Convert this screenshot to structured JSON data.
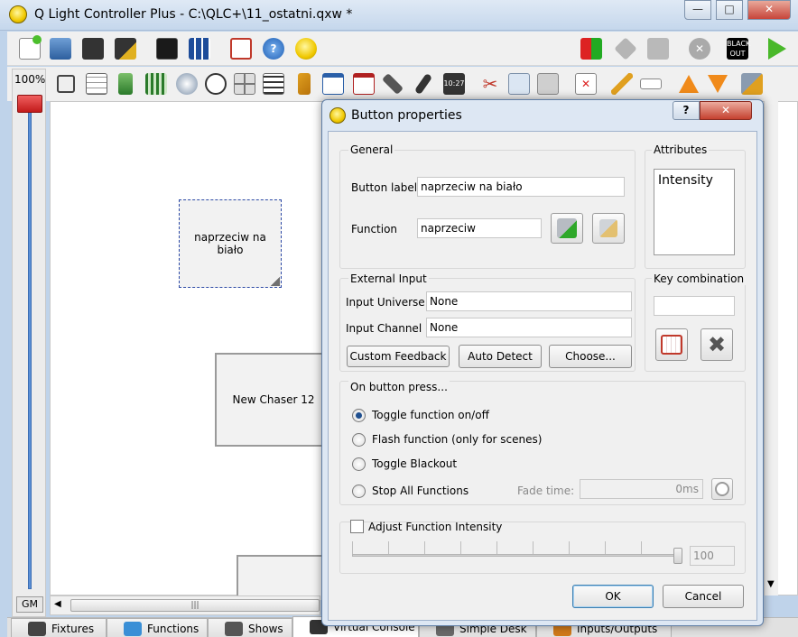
{
  "window": {
    "title": "Q Light Controller Plus - C:\\QLC+\\11_ostatni.qxw *",
    "minimize_glyph": "—",
    "maximize_glyph": "□",
    "close_glyph": "✕"
  },
  "toolbar_main": {
    "icons": [
      "new-file-icon",
      "open-file-icon",
      "save-file-icon",
      "save-as-icon",
      "monitor-icon",
      "address-tool-icon",
      "fullscreen-icon",
      "help-icon",
      "about-icon",
      "mode-switch-icon",
      "panic-icon",
      "stop-all-icon",
      "cross-icon",
      "blackout-icon",
      "play-icon"
    ],
    "blackout_label": "BLACK OUT"
  },
  "toolbar_vc": {
    "icons": [
      "button-icon",
      "button-matrix-icon",
      "slider-icon",
      "slider-matrix-icon",
      "knob-icon",
      "speed-dial-icon",
      "xy-pad-icon",
      "cue-list-icon",
      "label-icon",
      "frame-icon",
      "solo-frame-icon",
      "audio-icon",
      "microphone-icon",
      "clock-icon",
      "cut-icon",
      "copy-icon",
      "paste-icon",
      "delete-icon",
      "edit-icon",
      "rename-icon",
      "raise-icon",
      "lower-icon",
      "properties-icon"
    ]
  },
  "gm_panel": {
    "zoom": "100%",
    "gm_label": "GM"
  },
  "canvas": {
    "buttons": [
      {
        "label": "naprzeciw na biało"
      },
      {
        "label": "New Chaser 12"
      },
      {
        "label": ""
      }
    ],
    "hscroll_grip": "|||"
  },
  "tabs": [
    {
      "label": "Fixtures",
      "icon": "fixtures-icon",
      "color": "#444444"
    },
    {
      "label": "Functions",
      "icon": "functions-icon",
      "color": "#3a8fd6"
    },
    {
      "label": "Shows",
      "icon": "shows-icon",
      "color": "#555555"
    },
    {
      "label": "Virtual Console",
      "icon": "virtual-console-icon",
      "color": "#333333"
    },
    {
      "label": "Simple Desk",
      "icon": "simple-desk-icon",
      "color": "#6a6a6a"
    },
    {
      "label": "Inputs/Outputs",
      "icon": "inputs-outputs-icon",
      "color": "#d07a1a"
    }
  ],
  "dialog": {
    "title": "Button properties",
    "help": "?",
    "close": "✕",
    "general": {
      "title": "General",
      "button_label_caption": "Button label",
      "button_label_value": "naprzeciw na biało",
      "function_caption": "Function",
      "function_value": "naprzeciw"
    },
    "attributes": {
      "title": "Attributes",
      "items": [
        "Intensity"
      ]
    },
    "external_input": {
      "title": "External Input",
      "universe_caption": "Input Universe",
      "universe_value": "None",
      "channel_caption": "Input Channel",
      "channel_value": "None",
      "custom_feedback": "Custom Feedback",
      "auto_detect": "Auto Detect",
      "choose": "Choose..."
    },
    "key_combination": {
      "title": "Key combination",
      "value": ""
    },
    "on_press": {
      "title": "On button press...",
      "options": [
        {
          "label": "Toggle function on/off",
          "checked": true
        },
        {
          "label": "Flash function (only for scenes)",
          "checked": false
        },
        {
          "label": "Toggle Blackout",
          "checked": false
        },
        {
          "label": "Stop All Functions",
          "checked": false
        }
      ],
      "fade_caption": "Fade time:",
      "fade_value": "0ms"
    },
    "intensity": {
      "label": "Adjust Function Intensity",
      "checked": false,
      "value": "100",
      "level": 1.0
    },
    "ok": "OK",
    "cancel": "Cancel"
  }
}
